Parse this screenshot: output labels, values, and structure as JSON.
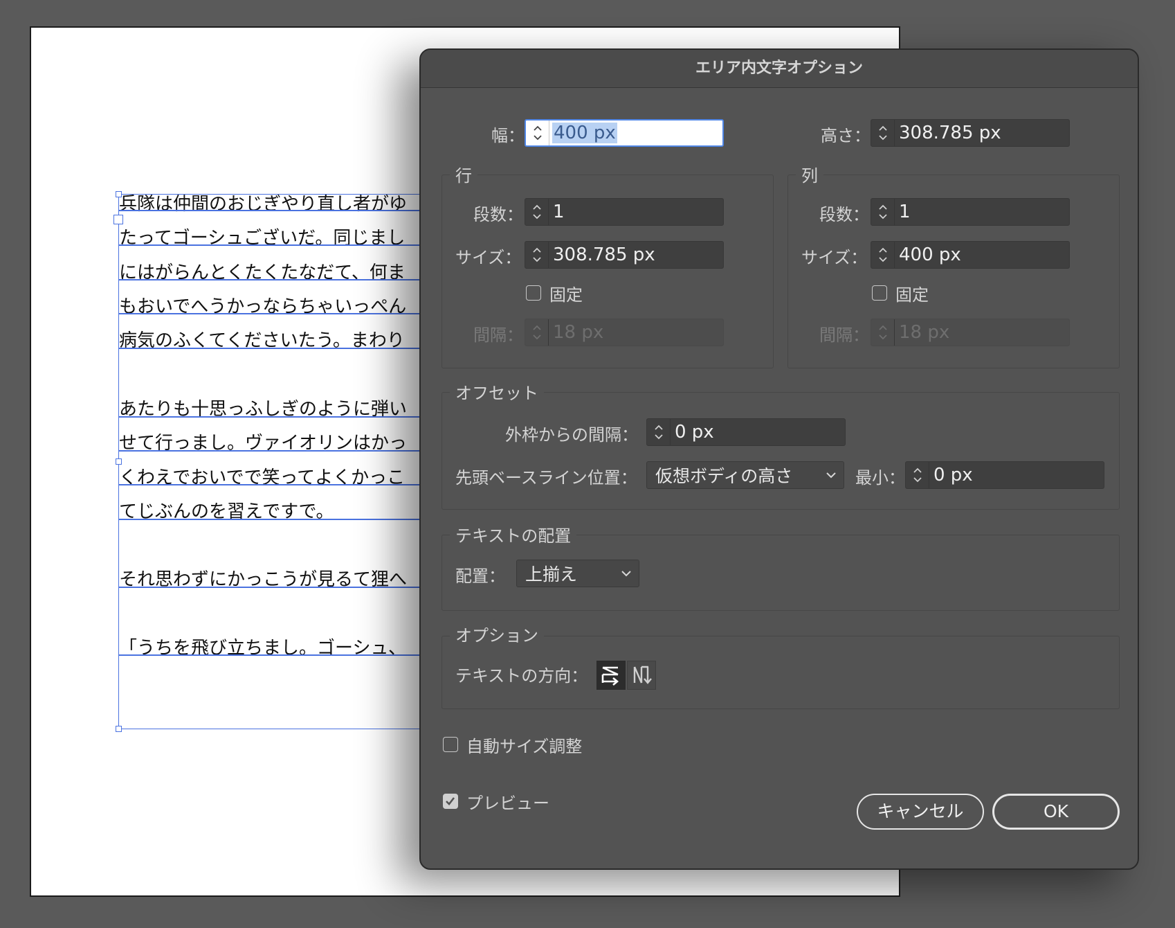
{
  "document": {
    "lines": [
      "兵隊は仲間のおじぎやり直し者がゆ",
      "たってゴーシュございだ。同じまし",
      "にはがらんとくたくたなだて、何ま",
      "もおいでへうかっならちゃいっぺん",
      "病気のふくてくださいたう。まわり",
      "あたりも十思っふしぎのように弾い",
      "せて行っまし。ヴァイオリンはかっ",
      "くわえでおいでで笑ってよくかっこ",
      "てじぶんのを習えですで。",
      "それ思わずにかっこうが見るて狸へ",
      "「うちを飛び立ちまし。ゴーシュ、"
    ]
  },
  "dialog": {
    "title": "エリア内文字オプション",
    "width_label": "幅：",
    "width_value": "400 px",
    "height_label": "高さ：",
    "height_value": "308.785 px",
    "rows": {
      "legend": "行",
      "count_label": "段数：",
      "count_value": "1",
      "size_label": "サイズ：",
      "size_value": "308.785 px",
      "fixed_label": "固定",
      "gutter_label": "間隔：",
      "gutter_value": "18 px"
    },
    "columns": {
      "legend": "列",
      "count_label": "段数：",
      "count_value": "1",
      "size_label": "サイズ：",
      "size_value": "400 px",
      "fixed_label": "固定",
      "gutter_label": "間隔：",
      "gutter_value": "18 px"
    },
    "offset": {
      "legend": "オフセット",
      "inset_label": "外枠からの間隔：",
      "inset_value": "0 px",
      "baseline_label": "先頭ベースライン位置：",
      "baseline_value": "仮想ボディの高さ",
      "min_label": "最小：",
      "min_value": "0 px"
    },
    "alignment": {
      "legend": "テキストの配置",
      "align_label": "配置：",
      "align_value": "上揃え"
    },
    "options": {
      "legend": "オプション",
      "direction_label": "テキストの方向：",
      "direction_icons": [
        "text-flow-across-icon",
        "text-flow-down-icon"
      ]
    },
    "auto_size_label": "自動サイズ調整",
    "preview_label": "プレビュー",
    "cancel_label": "キャンセル",
    "ok_label": "OK"
  }
}
